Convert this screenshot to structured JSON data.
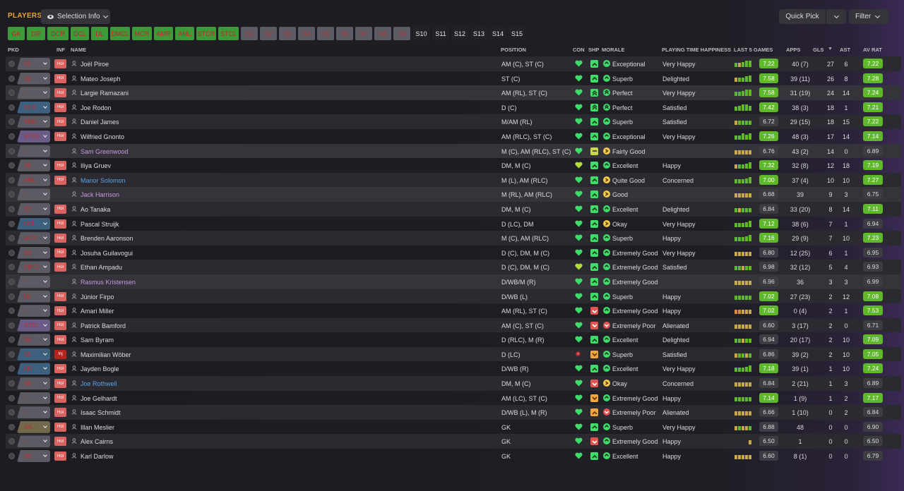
{
  "header": {
    "title": "PLAYERS",
    "selection_info": "Selection Info",
    "quick_pick": "Quick Pick",
    "filter": "Filter"
  },
  "positions": [
    {
      "label": "GK",
      "state": "filled"
    },
    {
      "label": "DR",
      "state": "filled"
    },
    {
      "label": "DCR",
      "state": "filled"
    },
    {
      "label": "DCL",
      "state": "filled"
    },
    {
      "label": "DL",
      "state": "filled"
    },
    {
      "label": "DMCL",
      "state": "filled"
    },
    {
      "label": "MCR",
      "state": "filled"
    },
    {
      "label": "AMR",
      "state": "filled"
    },
    {
      "label": "AML",
      "state": "filled"
    },
    {
      "label": "STCR",
      "state": "filled"
    },
    {
      "label": "STCL",
      "state": "filled"
    },
    {
      "label": "S1",
      "state": "sub"
    },
    {
      "label": "S2",
      "state": "sub"
    },
    {
      "label": "S3",
      "state": "sub"
    },
    {
      "label": "S4",
      "state": "sub"
    },
    {
      "label": "S5",
      "state": "sub"
    },
    {
      "label": "S6",
      "state": "sub"
    },
    {
      "label": "S7",
      "state": "sub"
    },
    {
      "label": "S8",
      "state": "sub"
    },
    {
      "label": "S9",
      "state": "sub"
    },
    {
      "label": "S10",
      "state": "empty"
    },
    {
      "label": "S11",
      "state": "empty"
    },
    {
      "label": "S12",
      "state": "empty"
    },
    {
      "label": "S13",
      "state": "empty"
    },
    {
      "label": "S14",
      "state": "empty"
    },
    {
      "label": "S15",
      "state": "empty"
    }
  ],
  "columns": {
    "pkd": "PKD",
    "inf": "INF",
    "name": "NAME",
    "position": "POSITION",
    "con": "CON",
    "shp": "SHP",
    "morale": "MORALE",
    "pth": "PLAYING TIME HAPPINESS",
    "last5": "LAST 5 GAMES",
    "apps": "APPS",
    "gls": "GLS",
    "ast": "AST",
    "avrat": "AV RAT"
  },
  "players": [
    {
      "pkd": "S1",
      "pkd_color": "grey",
      "inf": "Hol",
      "name": "Joël Piroe",
      "name_style": "normal",
      "position": "AM (C), ST (C)",
      "con": "green",
      "shp": "up",
      "morale_icon": "up",
      "morale": "Exceptional",
      "pth": "Very Happy",
      "form": [
        "g",
        "y",
        "g",
        "g",
        "g"
      ],
      "form_level": [
        0.55,
        0.55,
        0.7,
        0.85,
        0.9
      ],
      "last": "7.22",
      "last_hl": true,
      "apps": "40 (7)",
      "gls": "27",
      "ast": "6",
      "av": "7.22",
      "av_hl": true
    },
    {
      "pkd": "S2",
      "pkd_color": "grey",
      "inf": "Hol",
      "name": "Mateo Joseph",
      "name_style": "normal",
      "position": "ST (C)",
      "con": "green",
      "shp": "up",
      "morale_icon": "up",
      "morale": "Superb",
      "pth": "Delighted",
      "form": [
        "y",
        "g",
        "g",
        "g",
        "g"
      ],
      "form_level": [
        0.55,
        0.55,
        0.55,
        0.75,
        0.85
      ],
      "last": "7.58",
      "last_hl": true,
      "apps": "39 (11)",
      "gls": "26",
      "ast": "8",
      "av": "7.28",
      "av_hl": true
    },
    {
      "pkd": "-",
      "pkd_color": "grey",
      "inf": "Hol",
      "name": "Largie Ramazani",
      "name_style": "normal",
      "position": "AM (RL), ST (C)",
      "con": "green",
      "shp": "up2",
      "morale_icon": "up2",
      "morale": "Perfect",
      "pth": "Very Happy",
      "form": [
        "g",
        "g",
        "g",
        "g",
        "g"
      ],
      "form_level": [
        0.55,
        0.55,
        0.7,
        0.85,
        0.9
      ],
      "last": "7.58",
      "last_hl": true,
      "apps": "31 (19)",
      "gls": "24",
      "ast": "14",
      "av": "7.24",
      "av_hl": true
    },
    {
      "pkd": "DCR",
      "pkd_color": "blue",
      "inf": "Hol",
      "name": "Joe Rodon",
      "name_style": "normal",
      "position": "D (C)",
      "con": "green",
      "shp": "up2",
      "morale_icon": "up2",
      "morale": "Perfect",
      "pth": "Satisfied",
      "form": [
        "g",
        "g",
        "g",
        "g",
        "g"
      ],
      "form_level": [
        0.55,
        0.7,
        0.9,
        0.85,
        0.7
      ],
      "last": "7.42",
      "last_hl": true,
      "apps": "38 (3)",
      "gls": "18",
      "ast": "1",
      "av": "7.21",
      "av_hl": true
    },
    {
      "pkd": "AMR",
      "pkd_color": "grey",
      "inf": "Hol",
      "name": "Daniel James",
      "name_style": "normal",
      "position": "M/AM (RL)",
      "con": "green",
      "shp": "up",
      "morale_icon": "up",
      "morale": "Superb",
      "pth": "Satisfied",
      "form": [
        "y",
        "g",
        "g",
        "g",
        "g"
      ],
      "form_level": [
        0.55,
        0.55,
        0.55,
        0.55,
        0.55
      ],
      "last": "6.72",
      "last_hl": false,
      "apps": "29 (15)",
      "gls": "18",
      "ast": "15",
      "av": "7.22",
      "av_hl": true
    },
    {
      "pkd": "STCR",
      "pkd_color": "purple",
      "inf": "Hol",
      "name": "Wilfried Gnonto",
      "name_style": "normal",
      "position": "AM (RLC), ST (C)",
      "con": "green",
      "shp": "up",
      "morale_icon": "up",
      "morale": "Exceptional",
      "pth": "Very Happy",
      "form": [
        "g",
        "g",
        "g",
        "g",
        "g"
      ],
      "form_level": [
        0.55,
        0.55,
        0.85,
        0.7,
        0.9
      ],
      "last": "7.26",
      "last_hl": true,
      "apps": "48 (3)",
      "gls": "17",
      "ast": "14",
      "av": "7.14",
      "av_hl": true
    },
    {
      "pkd": "-",
      "pkd_color": "grey",
      "inf": "",
      "name": "Sam Greenwood",
      "name_style": "violet",
      "position": "M (C), AM (RLC), ST (C)",
      "con": "green",
      "shp": "flat",
      "morale_icon": "flat",
      "morale": "Fairly Good",
      "pth": "",
      "form": [
        "y",
        "y",
        "y",
        "y",
        "y"
      ],
      "form_level": [
        0.55,
        0.55,
        0.55,
        0.55,
        0.55
      ],
      "last": "6.76",
      "last_hl": false,
      "apps": "43 (2)",
      "gls": "14",
      "ast": "0",
      "av": "6.89",
      "av_hl": false
    },
    {
      "pkd": "S6",
      "pkd_color": "grey",
      "inf": "Hol",
      "name": "Iliya Gruev",
      "name_style": "normal",
      "position": "DM, M (C)",
      "con": "yellowgreen",
      "shp": "up",
      "morale_icon": "up",
      "morale": "Excellent",
      "pth": "Happy",
      "form": [
        "y",
        "g",
        "g",
        "g",
        "g"
      ],
      "form_level": [
        0.55,
        0.55,
        0.55,
        0.7,
        0.85
      ],
      "last": "7.32",
      "last_hl": true,
      "apps": "32 (8)",
      "gls": "12",
      "ast": "18",
      "av": "7.19",
      "av_hl": true
    },
    {
      "pkd": "AML",
      "pkd_color": "grey",
      "inf": "Hol",
      "name": "Manor Solomon",
      "name_style": "blue",
      "position": "M (L), AM (RLC)",
      "con": "green",
      "shp": "up",
      "morale_icon": "flat",
      "morale": "Quite Good",
      "pth": "Concerned",
      "form": [
        "g",
        "g",
        "g",
        "g",
        "g"
      ],
      "form_level": [
        0.55,
        0.55,
        0.55,
        0.7,
        0.85
      ],
      "last": "7.00",
      "last_hl": true,
      "apps": "37 (4)",
      "gls": "10",
      "ast": "10",
      "av": "7.27",
      "av_hl": true
    },
    {
      "pkd": "-",
      "pkd_color": "grey",
      "inf": "",
      "name": "Jack Harrison",
      "name_style": "violet",
      "position": "M (RL), AM (RLC)",
      "con": "green",
      "shp": "up",
      "morale_icon": "flat",
      "morale": "Good",
      "pth": "",
      "form": [
        "y",
        "y",
        "y",
        "y",
        "y"
      ],
      "form_level": [
        0.55,
        0.55,
        0.55,
        0.55,
        0.55
      ],
      "last": "6.68",
      "last_hl": false,
      "apps": "39",
      "gls": "9",
      "ast": "3",
      "av": "6.75",
      "av_hl": false
    },
    {
      "pkd": "S7",
      "pkd_color": "grey",
      "inf": "Hol",
      "name": "Ao Tanaka",
      "name_style": "normal",
      "position": "DM, M (C)",
      "con": "green",
      "shp": "up",
      "morale_icon": "up",
      "morale": "Excellent",
      "pth": "Delighted",
      "form": [
        "g",
        "y",
        "g",
        "g",
        "g"
      ],
      "form_level": [
        0.55,
        0.55,
        0.55,
        0.55,
        0.55
      ],
      "last": "6.84",
      "last_hl": false,
      "apps": "33 (20)",
      "gls": "8",
      "ast": "14",
      "av": "7.11",
      "av_hl": true
    },
    {
      "pkd": "DCL",
      "pkd_color": "blue",
      "inf": "Hol",
      "name": "Pascal Struijk",
      "name_style": "normal",
      "position": "D (LC), DM",
      "con": "green",
      "shp": "up",
      "morale_icon": "flat",
      "morale": "Okay",
      "pth": "Very Happy",
      "form": [
        "g",
        "g",
        "g",
        "g",
        "g"
      ],
      "form_level": [
        0.55,
        0.55,
        0.55,
        0.7,
        0.85
      ],
      "last": "7.12",
      "last_hl": true,
      "apps": "38 (6)",
      "gls": "7",
      "ast": "1",
      "av": "6.94",
      "av_hl": false
    },
    {
      "pkd": "MCR",
      "pkd_color": "grey",
      "inf": "Hol",
      "name": "Brenden Aaronson",
      "name_style": "normal",
      "position": "M (C), AM (RLC)",
      "con": "green",
      "shp": "up",
      "morale_icon": "up",
      "morale": "Superb",
      "pth": "Happy",
      "form": [
        "g",
        "g",
        "g",
        "g",
        "g"
      ],
      "form_level": [
        0.55,
        0.55,
        0.55,
        0.7,
        0.85
      ],
      "last": "7.16",
      "last_hl": true,
      "apps": "29 (9)",
      "gls": "7",
      "ast": "10",
      "av": "7.23",
      "av_hl": true
    },
    {
      "pkd": "S3",
      "pkd_color": "grey",
      "inf": "Hol",
      "name": "Josuha Guilavogui",
      "name_style": "normal",
      "position": "D (C), DM, M (C)",
      "con": "green",
      "shp": "up",
      "morale_icon": "up",
      "morale": "Extremely Good",
      "pth": "Very Happy",
      "form": [
        "y",
        "y",
        "y",
        "y",
        "y"
      ],
      "form_level": [
        0.55,
        0.55,
        0.55,
        0.55,
        0.55
      ],
      "last": "6.80",
      "last_hl": false,
      "apps": "12 (25)",
      "gls": "6",
      "ast": "1",
      "av": "6.95",
      "av_hl": false
    },
    {
      "pkd": "DMCL",
      "pkd_color": "grey",
      "inf": "Hol",
      "name": "Ethan Ampadu",
      "name_style": "normal",
      "position": "D (C), DM, M (C)",
      "con": "yellowgreen",
      "shp": "up",
      "morale_icon": "up",
      "morale": "Extremely Good",
      "pth": "Satisfied",
      "form": [
        "g",
        "g",
        "y",
        "g",
        "g"
      ],
      "form_level": [
        0.55,
        0.55,
        0.55,
        0.55,
        0.55
      ],
      "last": "6.98",
      "last_hl": false,
      "apps": "32 (12)",
      "gls": "5",
      "ast": "4",
      "av": "6.93",
      "av_hl": false
    },
    {
      "pkd": "-",
      "pkd_color": "grey",
      "inf": "",
      "name": "Rasmus Kristensen",
      "name_style": "violet",
      "position": "D/WB/M (R)",
      "con": "green",
      "shp": "up",
      "morale_icon": "up",
      "morale": "Extremely Good",
      "pth": "",
      "form": [
        "y",
        "y",
        "y",
        "y",
        "y"
      ],
      "form_level": [
        0.55,
        0.55,
        0.55,
        0.55,
        0.55
      ],
      "last": "6.96",
      "last_hl": false,
      "apps": "36",
      "gls": "3",
      "ast": "3",
      "av": "6.99",
      "av_hl": false
    },
    {
      "pkd": "DL",
      "pkd_color": "grey",
      "inf": "Hol",
      "name": "Júnior Firpo",
      "name_style": "normal",
      "position": "D/WB (L)",
      "con": "green",
      "shp": "up",
      "morale_icon": "up",
      "morale": "Superb",
      "pth": "Happy",
      "form": [
        "g",
        "g",
        "g",
        "g",
        "g"
      ],
      "form_level": [
        0.55,
        0.55,
        0.55,
        0.55,
        0.55
      ],
      "last": "7.02",
      "last_hl": true,
      "apps": "27 (23)",
      "gls": "2",
      "ast": "12",
      "av": "7.08",
      "av_hl": true
    },
    {
      "pkd": "-",
      "pkd_color": "grey",
      "inf": "Hol",
      "name": "Amari Miller",
      "name_style": "normal",
      "position": "AM (RL), ST (C)",
      "con": "green",
      "shp": "red",
      "morale_icon": "up",
      "morale": "Extremely Good",
      "pth": "Happy",
      "form": [
        "o",
        "o",
        "y",
        "y",
        "y"
      ],
      "form_level": [
        0.55,
        0.55,
        0.55,
        0.55,
        0.55
      ],
      "last": "7.02",
      "last_hl": true,
      "apps": "0 (4)",
      "gls": "2",
      "ast": "1",
      "av": "7.53",
      "av_hl": true
    },
    {
      "pkd": "STCL",
      "pkd_color": "purple",
      "inf": "Hol",
      "name": "Patrick Bamford",
      "name_style": "normal",
      "position": "AM (C), ST (C)",
      "con": "green",
      "shp": "red",
      "morale_icon": "down",
      "morale": "Extremely Poor",
      "pth": "Alienated",
      "form": [
        "y",
        "y",
        "y",
        "y",
        "y"
      ],
      "form_level": [
        0.55,
        0.55,
        0.55,
        0.55,
        0.55
      ],
      "last": "6.60",
      "last_hl": false,
      "apps": "3 (17)",
      "gls": "2",
      "ast": "0",
      "av": "6.71",
      "av_hl": false
    },
    {
      "pkd": "S4",
      "pkd_color": "grey",
      "inf": "Hol",
      "name": "Sam Byram",
      "name_style": "normal",
      "position": "D (RLC), M (R)",
      "con": "green",
      "shp": "up",
      "morale_icon": "up",
      "morale": "Excellent",
      "pth": "Delighted",
      "form": [
        "g",
        "g",
        "y",
        "g",
        "g"
      ],
      "form_level": [
        0.55,
        0.55,
        0.55,
        0.55,
        0.55
      ],
      "last": "6.94",
      "last_hl": false,
      "apps": "20 (17)",
      "gls": "2",
      "ast": "10",
      "av": "7.09",
      "av_hl": true
    },
    {
      "pkd": "S5",
      "pkd_color": "blue",
      "inf": "Inj",
      "name": "Maximilian Wöber",
      "name_style": "normal",
      "position": "D (LC)",
      "con": "red",
      "shp": "orange",
      "morale_icon": "up",
      "morale": "Superb",
      "pth": "Satisfied",
      "form": [
        "y",
        "g",
        "g",
        "y",
        "g"
      ],
      "form_level": [
        0.55,
        0.55,
        0.55,
        0.55,
        0.55
      ],
      "last": "6.86",
      "last_hl": false,
      "apps": "39 (2)",
      "gls": "2",
      "ast": "10",
      "av": "7.05",
      "av_hl": true
    },
    {
      "pkd": "DR",
      "pkd_color": "blue",
      "inf": "Hol",
      "name": "Jayden Bogle",
      "name_style": "normal",
      "position": "D/WB (R)",
      "con": "green",
      "shp": "up",
      "morale_icon": "up",
      "morale": "Excellent",
      "pth": "Very Happy",
      "form": [
        "g",
        "g",
        "g",
        "g",
        "g"
      ],
      "form_level": [
        0.55,
        0.55,
        0.55,
        0.7,
        0.85
      ],
      "last": "7.18",
      "last_hl": true,
      "apps": "39 (1)",
      "gls": "1",
      "ast": "10",
      "av": "7.24",
      "av_hl": true
    },
    {
      "pkd": "S8",
      "pkd_color": "grey",
      "inf": "Hol",
      "name": "Joe Rothwell",
      "name_style": "blue",
      "position": "DM, M (C)",
      "con": "green",
      "shp": "red",
      "morale_icon": "flat",
      "morale": "Okay",
      "pth": "Concerned",
      "form": [
        "y",
        "y",
        "y",
        "y",
        "y"
      ],
      "form_level": [
        0.55,
        0.55,
        0.55,
        0.55,
        0.55
      ],
      "last": "6.84",
      "last_hl": false,
      "apps": "2 (21)",
      "gls": "1",
      "ast": "3",
      "av": "6.89",
      "av_hl": false
    },
    {
      "pkd": "-",
      "pkd_color": "grey",
      "inf": "Hol",
      "name": "Joe Gelhardt",
      "name_style": "normal",
      "position": "AM (LC), ST (C)",
      "con": "green",
      "shp": "orange",
      "morale_icon": "up",
      "morale": "Extremely Good",
      "pth": "Happy",
      "form": [
        "g",
        "g",
        "g",
        "g",
        "g"
      ],
      "form_level": [
        0.55,
        0.55,
        0.55,
        0.55,
        0.55
      ],
      "last": "7.14",
      "last_hl": true,
      "apps": "1 (9)",
      "gls": "1",
      "ast": "2",
      "av": "7.17",
      "av_hl": true
    },
    {
      "pkd": "-",
      "pkd_color": "grey",
      "inf": "Hol",
      "name": "Isaac Schmidt",
      "name_style": "normal",
      "position": "D/WB (L), M (R)",
      "con": "green",
      "shp": "orange2",
      "morale_icon": "down",
      "morale": "Extremely Poor",
      "pth": "Alienated",
      "form": [
        "y",
        "y",
        "y",
        "y",
        "y"
      ],
      "form_level": [
        0.55,
        0.55,
        0.55,
        0.55,
        0.55
      ],
      "last": "6.66",
      "last_hl": false,
      "apps": "1 (10)",
      "gls": "0",
      "ast": "2",
      "av": "6.84",
      "av_hl": false
    },
    {
      "pkd": "GK",
      "pkd_color": "olive",
      "inf": "Hol",
      "name": "Illan Meslier",
      "name_style": "normal",
      "position": "GK",
      "con": "green",
      "shp": "up",
      "morale_icon": "up",
      "morale": "Superb",
      "pth": "Very Happy",
      "form": [
        "y",
        "g",
        "y",
        "y",
        "g"
      ],
      "form_level": [
        0.55,
        0.55,
        0.55,
        0.55,
        0.55
      ],
      "last": "6.88",
      "last_hl": false,
      "apps": "48",
      "gls": "0",
      "ast": "0",
      "av": "6.90",
      "av_hl": false
    },
    {
      "pkd": "-",
      "pkd_color": "grey",
      "inf": "Hol",
      "name": "Alex Cairns",
      "name_style": "normal",
      "position": "GK",
      "con": "green",
      "shp": "red",
      "morale_icon": "up",
      "morale": "Extremely Good",
      "pth": "Happy",
      "form": [
        "",
        "",
        "",
        "",
        "y"
      ],
      "form_level": [
        0,
        0,
        0,
        0,
        0.55
      ],
      "last": "6.50",
      "last_hl": false,
      "apps": "1",
      "gls": "0",
      "ast": "0",
      "av": "6.50",
      "av_hl": false
    },
    {
      "pkd": "S9",
      "pkd_color": "grey",
      "inf": "Hol",
      "name": "Karl Darlow",
      "name_style": "normal",
      "position": "GK",
      "con": "green",
      "shp": "up",
      "morale_icon": "up",
      "morale": "Excellent",
      "pth": "Happy",
      "form": [
        "y",
        "y",
        "y",
        "y",
        "y"
      ],
      "form_level": [
        0.55,
        0.55,
        0.55,
        0.55,
        0.55
      ],
      "last": "6.60",
      "last_hl": false,
      "apps": "8 (1)",
      "gls": "0",
      "ast": "0",
      "av": "6.79",
      "av_hl": false
    }
  ]
}
